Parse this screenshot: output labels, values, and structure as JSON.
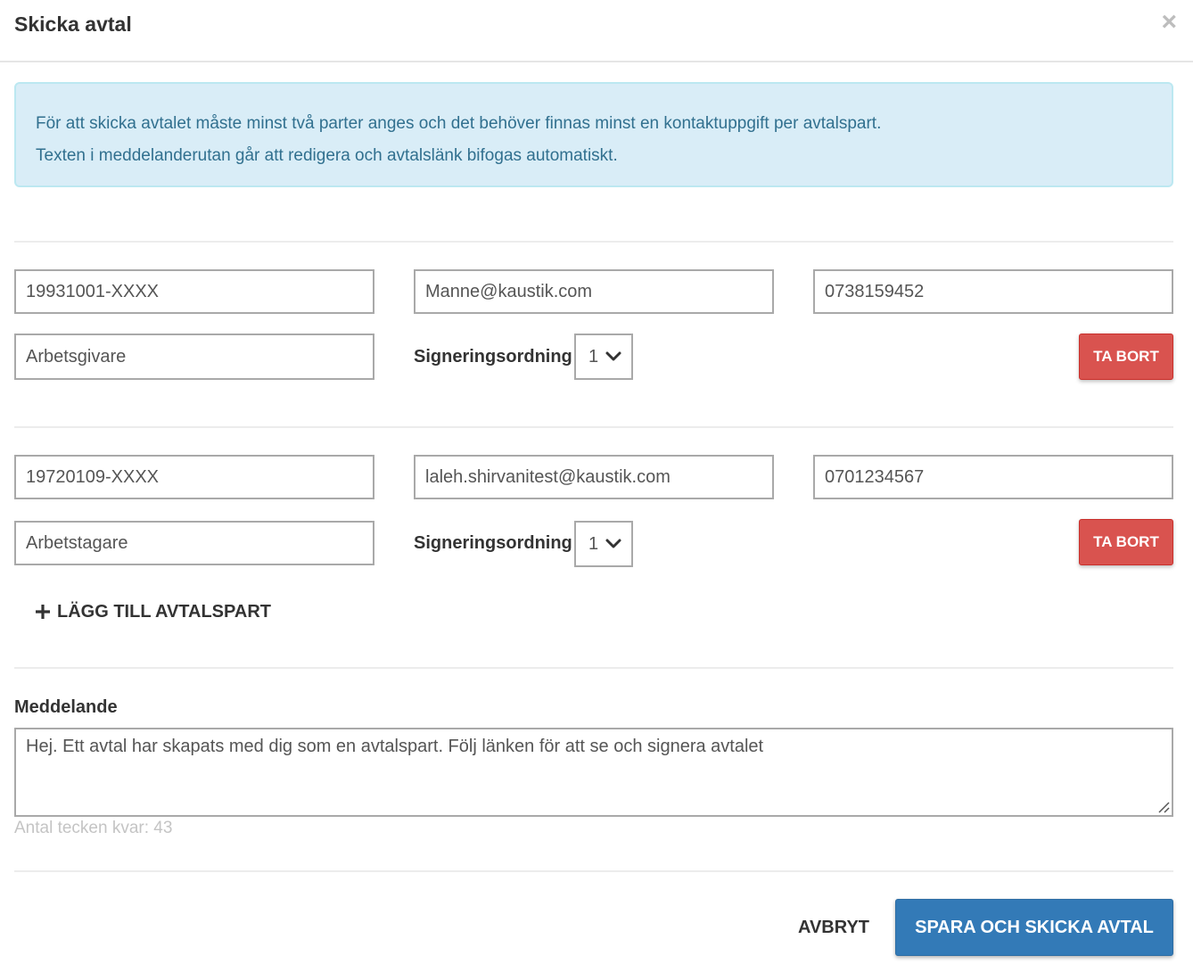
{
  "modal": {
    "title": "Skicka avtal",
    "close_symbol": "×",
    "close_icon": "close-icon"
  },
  "info": {
    "line1": "För att skicka avtalet måste minst två parter anges och det behöver finnas minst en kontaktuppgift per avtalspart.",
    "line2": "Texten i meddelanderutan går att redigera och avtalslänk bifogas automatiskt."
  },
  "parties": [
    {
      "personal_number": "19931001-XXXX",
      "email": "Manne@kaustik.com",
      "phone": "0738159452",
      "role": "Arbetsgivare",
      "signing_label": "Signeringsordning",
      "signing_order": "1",
      "remove_label": "TA BORT"
    },
    {
      "personal_number": "19720109-XXXX",
      "email": "laleh.shirvanitest@kaustik.com",
      "phone": "0701234567",
      "role": "Arbetstagare",
      "signing_label": "Signeringsordning",
      "signing_order": "1",
      "remove_label": "TA BORT"
    }
  ],
  "add_party_label": "LÄGG TILL AVTALSPART",
  "message": {
    "label": "Meddelande",
    "text": "Hej. Ett avtal har skapats med dig som en avtalspart. Följ länken för att se och signera avtalet",
    "chars_left": "Antal tecken kvar: 43"
  },
  "footer": {
    "cancel_label": "AVBRYT",
    "submit_label": "SPARA OCH SKICKA AVTAL"
  },
  "colors": {
    "danger": "#d9534f",
    "primary": "#337ab7",
    "info_bg": "#d9edf7",
    "info_text": "#31708f"
  }
}
